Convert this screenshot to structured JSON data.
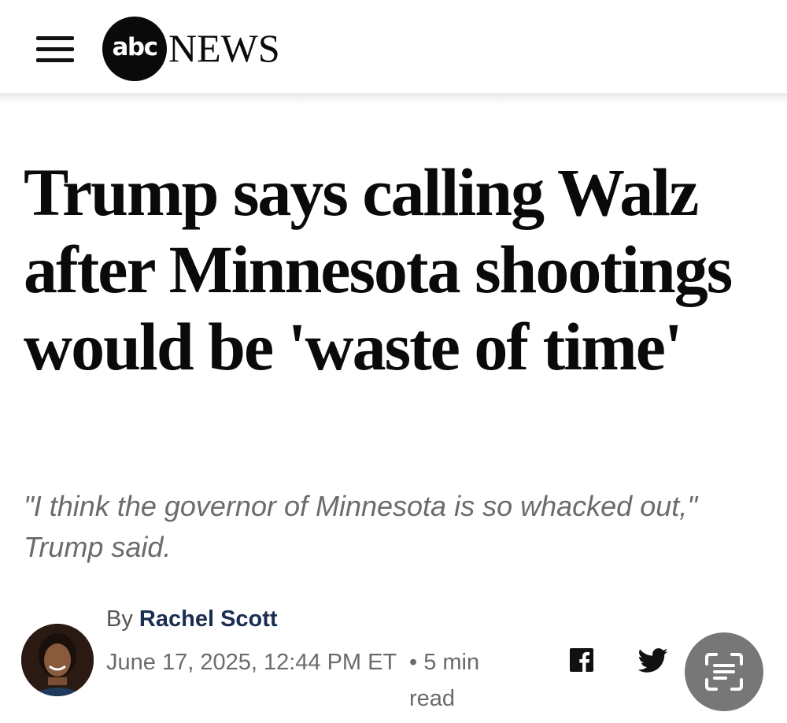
{
  "header": {
    "menu_icon": "hamburger-menu-icon",
    "logo_abc": "abc",
    "logo_news": "NEWS"
  },
  "article": {
    "headline": "Trump says calling Walz after Minnesota shootings would be 'waste of time'",
    "subhead": "\"I think the governor of Minnesota is so whacked out,\" Trump said.",
    "byline_prefix": "By",
    "author": "Rachel Scott",
    "date": "June 17, 2025, 12:44 PM ET",
    "read_time": "• 5 min read"
  },
  "share": {
    "facebook_icon": "facebook-icon",
    "twitter_icon": "twitter-icon"
  },
  "overlay": {
    "scan_icon": "text-scan-icon"
  },
  "colors": {
    "author_link": "#1a2e52",
    "subhead": "#6b6b6b",
    "scan_button": "#777777"
  }
}
